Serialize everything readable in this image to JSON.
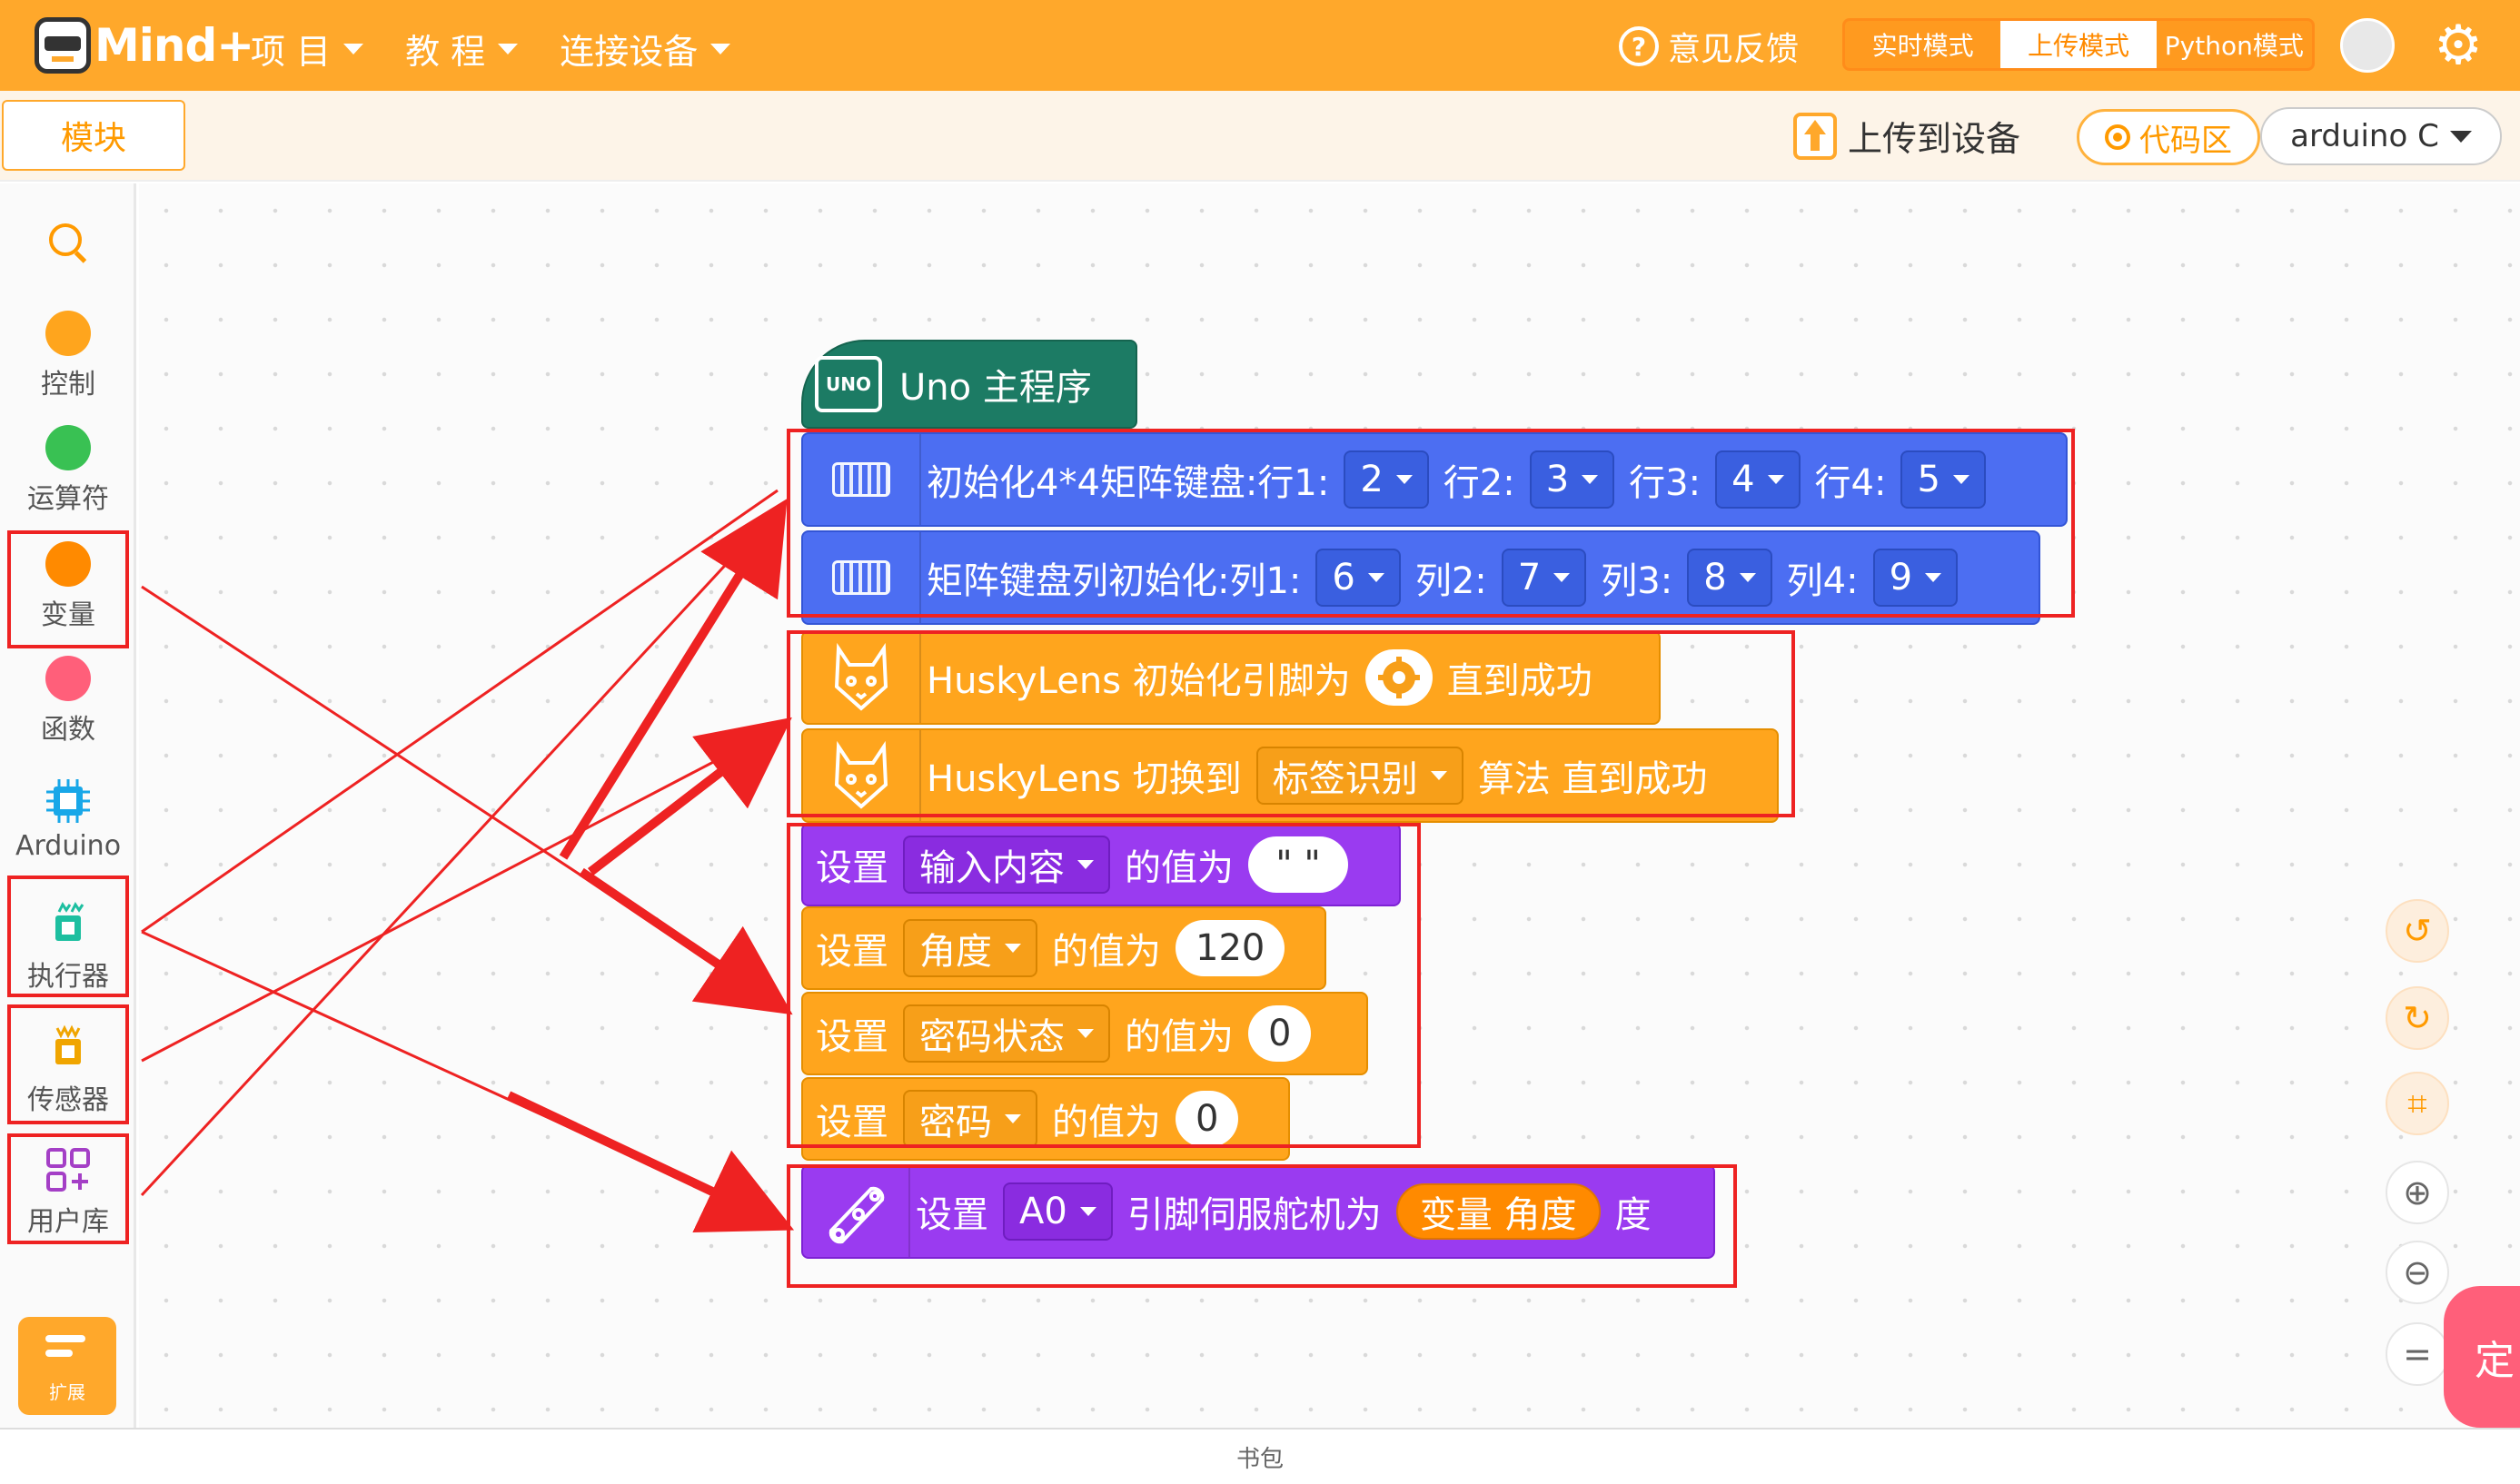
{
  "topbar": {
    "logo_text": "Mind+",
    "nav": [
      {
        "label": "项 目"
      },
      {
        "label": "教 程"
      },
      {
        "label": "连接设备"
      }
    ],
    "feedback_label": "意见反馈",
    "modes": [
      {
        "label": "实时模式",
        "active": false
      },
      {
        "label": "上传模式",
        "active": true
      },
      {
        "label": "Python模式",
        "active": false
      }
    ],
    "accent_color": "#ffa82b"
  },
  "subbar": {
    "module_tab": "模块",
    "upload_label": "上传到设备",
    "code_area_label": "代码区",
    "language": "arduino C"
  },
  "sidebar": {
    "categories": [
      {
        "label": "控制",
        "color": "#ffa51d"
      },
      {
        "label": "运算符",
        "color": "#39c153"
      },
      {
        "label": "变量",
        "color": "#ff8a00"
      },
      {
        "label": "函数",
        "color": "#ff5f7a"
      },
      {
        "label": "Arduino",
        "color": "#18a7e8"
      },
      {
        "label": "执行器",
        "color": "#1dbfa0"
      },
      {
        "label": "传感器",
        "color": "#f0a500"
      },
      {
        "label": "用户库",
        "color": "#a43fc6"
      }
    ],
    "extension_label": "扩展"
  },
  "blocks": {
    "hat": {
      "label": "Uno 主程序",
      "icon_text": "UNO"
    },
    "keypad_init": {
      "prefix": "初始化4*4矩阵键盘:行1:",
      "r1": "2",
      "l2": "行2:",
      "r2": "3",
      "l3": "行3:",
      "r3": "4",
      "l4": "行4:",
      "r4": "5"
    },
    "keypad_cols": {
      "prefix": "矩阵键盘列初始化:列1:",
      "c1": "6",
      "l2": "列2:",
      "c2": "7",
      "l3": "列3:",
      "c3": "8",
      "l4": "列4:",
      "c4": "9"
    },
    "husky_init": {
      "prefix": "HuskyLens 初始化引脚为",
      "suffix": "直到成功"
    },
    "husky_switch": {
      "prefix": "HuskyLens 切换到",
      "algo": "标签识别",
      "suffix": "算法 直到成功"
    },
    "set_vars": [
      {
        "set": "设置",
        "var": "输入内容",
        "of": "的值为",
        "value": "\"  \""
      },
      {
        "set": "设置",
        "var": "角度",
        "of": "的值为",
        "value": "120"
      },
      {
        "set": "设置",
        "var": "密码状态",
        "of": "的值为",
        "value": "0"
      },
      {
        "set": "设置",
        "var": "密码",
        "of": "的值为",
        "value": "0"
      }
    ],
    "servo": {
      "set": "设置",
      "pin": "A0",
      "mid": "引脚伺服舵机为",
      "var_value": "变量 角度",
      "unit": "度"
    }
  },
  "right_tab_label": "定",
  "backpack_label": "书包"
}
